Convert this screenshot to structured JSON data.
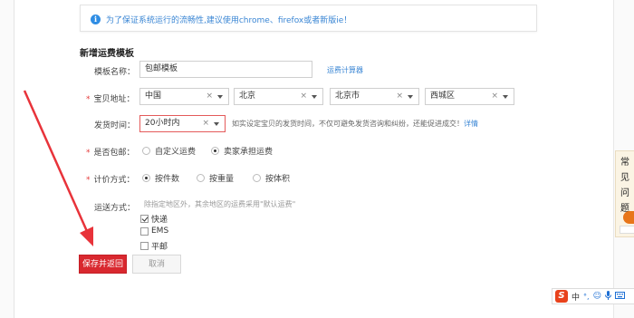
{
  "notice": {
    "text": "为了保证系统运行的流畅性,建议使用chrome、firefox或者新版ie！"
  },
  "section_title": "新增运费模板",
  "template_name": {
    "label": "模板名称：",
    "value": "包邮模板",
    "link": "运费计算器"
  },
  "location": {
    "label": "宝贝地址：",
    "country": "中国",
    "province": "北京",
    "city": "北京市",
    "district": "西城区"
  },
  "ship_time": {
    "label": "发货时间：",
    "value": "20小时内",
    "hint": "如实设定宝贝的发货时间，不仅可避免发货咨询和纠纷，还能促进成交！",
    "hint_link": "详情"
  },
  "free_shipping": {
    "label": "是否包邮：",
    "options": [
      "自定义运费",
      "卖家承担运费"
    ],
    "selected": "卖家承担运费"
  },
  "pricing": {
    "label": "计价方式：",
    "options": [
      "按件数",
      "按重量",
      "按体积"
    ],
    "selected": "按件数"
  },
  "delivery": {
    "label": "运送方式：",
    "note": "除指定地区外，其余地区的运费采用\"默认运费\"",
    "methods": [
      {
        "label": "快递",
        "checked": true
      },
      {
        "label": "EMS",
        "checked": false
      },
      {
        "label": "平邮",
        "checked": false
      }
    ]
  },
  "buttons": {
    "save": "保存并返回",
    "cancel": "取消"
  },
  "faq": {
    "chars": [
      "常",
      "见",
      "问",
      "题"
    ]
  },
  "ime": {
    "mode": "中",
    "icons": [
      "°,",
      "☺",
      "mic-icon",
      "keyboard-icon"
    ]
  },
  "colors": {
    "primary": "#d9282f",
    "link": "#3a86d4",
    "required": "#e43a3a",
    "arrow": "#e8333a"
  }
}
